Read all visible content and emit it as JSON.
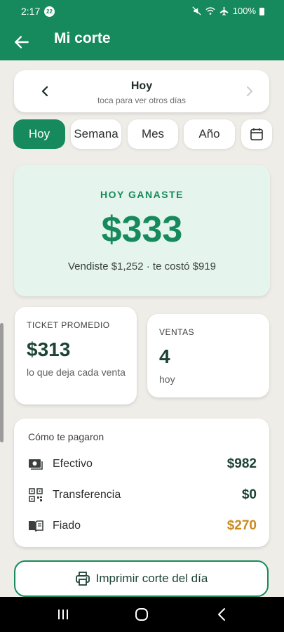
{
  "status": {
    "time": "2:17",
    "notifications": "22",
    "battery": "100%"
  },
  "appbar": {
    "title": "Mi corte"
  },
  "date_selector": {
    "title": "Hoy",
    "subtitle": "toca para ver otros días"
  },
  "periods": [
    {
      "label": "Hoy",
      "active": true
    },
    {
      "label": "Semana",
      "active": false
    },
    {
      "label": "Mes",
      "active": false
    },
    {
      "label": "Año",
      "active": false
    }
  ],
  "summary": {
    "label": "HOY GANASTE",
    "amount": "$333",
    "detail": "Vendiste $1,252 · te costó $919"
  },
  "ticket": {
    "label": "TICKET PROMEDIO",
    "value": "$313",
    "caption": "lo que deja cada venta"
  },
  "ventas": {
    "label": "VENTAS",
    "value": "4",
    "caption": "hoy"
  },
  "payments": {
    "title": "Cómo te pagaron",
    "items": [
      {
        "name": "Efectivo",
        "value": "$982",
        "icon": "cash-icon"
      },
      {
        "name": "Transferencia",
        "value": "$0",
        "icon": "qr-code-icon"
      },
      {
        "name": "Fiado",
        "value": "$270",
        "icon": "book-icon"
      }
    ]
  },
  "print_button": {
    "label": "Imprimir corte del día"
  },
  "colors": {
    "primary": "#168a5c",
    "hero_bg": "#e5f4ec",
    "fiado": "#c98a1e",
    "background": "#efede8"
  }
}
